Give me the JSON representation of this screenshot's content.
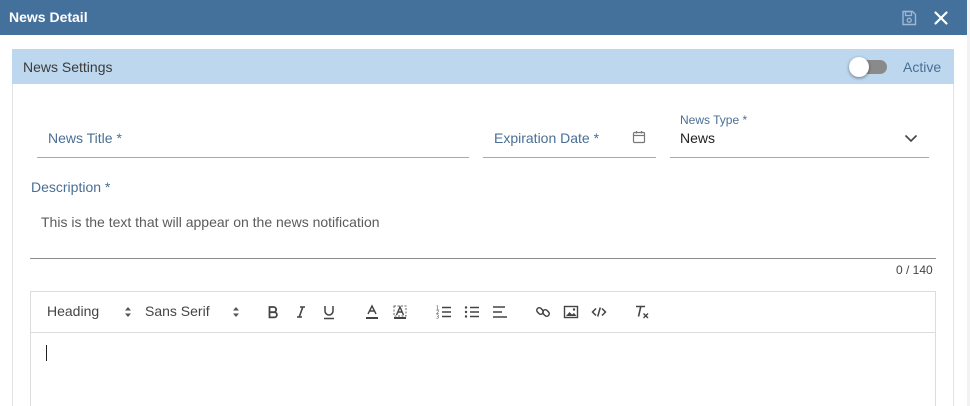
{
  "window": {
    "title": "News Detail"
  },
  "settings": {
    "header": "News Settings",
    "active_label": "Active",
    "active_on": false
  },
  "form": {
    "news_title_label": "News Title *",
    "expiration_label": "Expiration Date *",
    "news_type_label": "News Type *",
    "news_type_value": "News",
    "description_label": "Description *",
    "description_placeholder": "This is the text that will appear on the news notification",
    "counter": "0 / 140"
  },
  "editor": {
    "heading_select": "Heading",
    "font_select": "Sans Serif",
    "tools": [
      "bold-icon",
      "italic-icon",
      "underline-icon",
      "font-color-icon",
      "highlight-icon",
      "ordered-list-icon",
      "bullet-list-icon",
      "align-icon",
      "link-icon",
      "image-icon",
      "code-icon",
      "clear-format-icon"
    ]
  },
  "colors": {
    "titlebar": "#44709c",
    "header": "#bcd7ee",
    "label": "#4a6f95"
  }
}
